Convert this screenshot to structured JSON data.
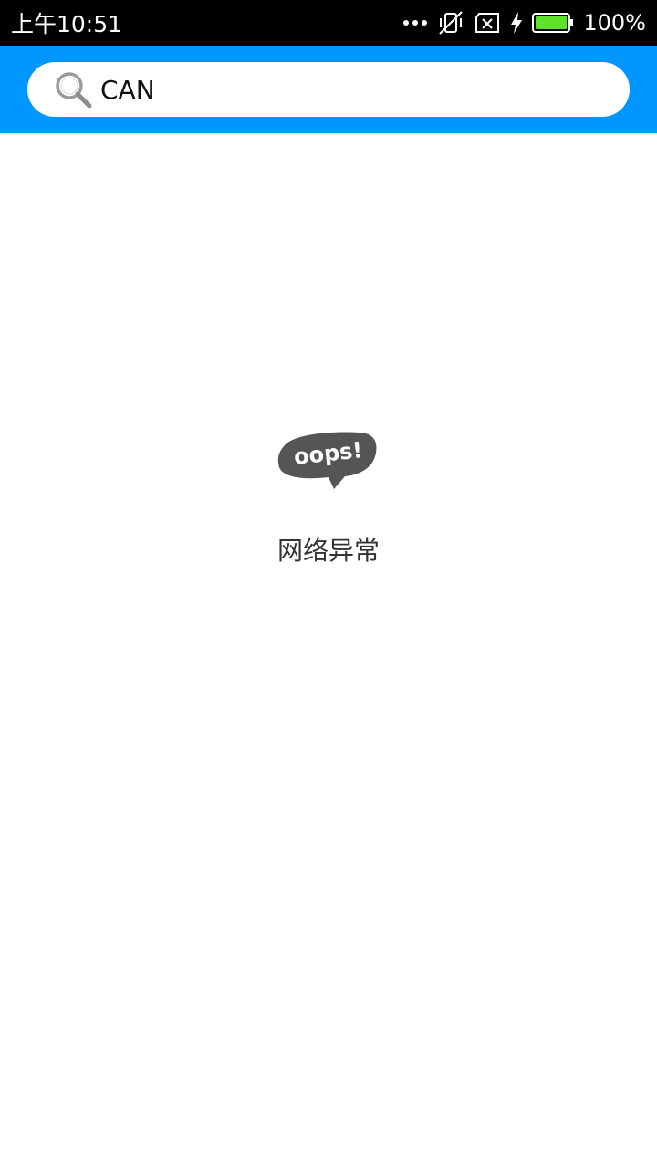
{
  "status_bar": {
    "time": "上午10:51",
    "battery": "100%",
    "icons": [
      "more-dots-icon",
      "vibrate-off-icon",
      "no-sim-icon",
      "charging-bolt-icon",
      "battery-icon"
    ],
    "battery_color": "#5ee22b"
  },
  "search": {
    "value": "CAN",
    "icon": "search-icon"
  },
  "colors": {
    "app_bar": "#0096ff",
    "illustration": "#555555"
  },
  "empty_state": {
    "illustration_text": "oops!",
    "message": "网络异常"
  }
}
